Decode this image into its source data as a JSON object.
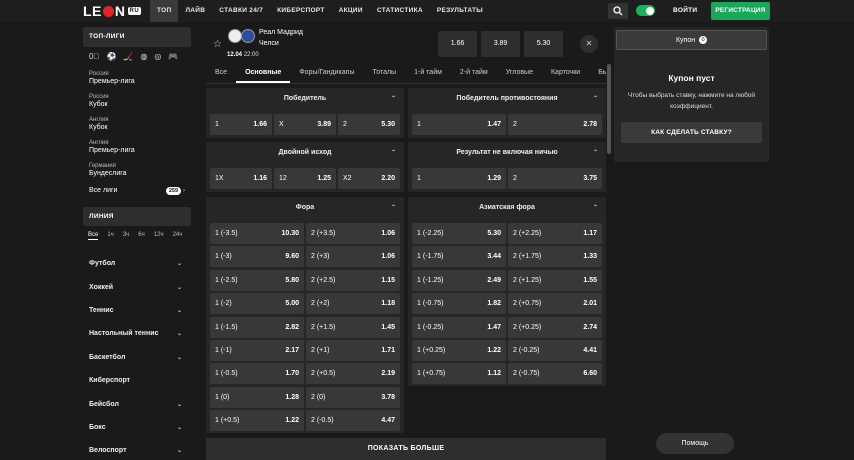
{
  "header": {
    "logo": "LEON",
    "logo_badge": "RU",
    "nav": [
      "ТОП",
      "ЛАЙВ",
      "СТАВКИ 24/7",
      "КИБЕРСПОРТ",
      "АКЦИИ",
      "СТАТИСТИКА",
      "РЕЗУЛЬТАТЫ"
    ],
    "login": "ВОЙТИ",
    "register": "РЕГИСТРАЦИЯ"
  },
  "sidebar": {
    "top_leagues_title": "ТОП-ЛИГИ",
    "leagues": [
      {
        "country": "Россия",
        "name": "Премьер-лига"
      },
      {
        "country": "Россия",
        "name": "Кубок"
      },
      {
        "country": "Англия",
        "name": "Кубок"
      },
      {
        "country": "Англия",
        "name": "Премьер-лига"
      },
      {
        "country": "Германия",
        "name": "Бундеслига"
      }
    ],
    "all_leagues": "Все лиги",
    "all_leagues_count": "259",
    "line_title": "ЛИНИЯ",
    "ranges": [
      "Все",
      "1ч",
      "3ч",
      "6ч",
      "12ч",
      "24ч"
    ],
    "sports": [
      "Футбол",
      "Хоккей",
      "Теннис",
      "Настольный теннис",
      "Баскетбол",
      "Киберспорт",
      "Бейсбол",
      "Бокс",
      "Велоспорт"
    ]
  },
  "match": {
    "team1": "Реал Мадрид",
    "team2": "Челси",
    "date": "12.04",
    "time": "22:00",
    "odds": [
      "1.66",
      "3.89",
      "5.30"
    ]
  },
  "tabs": [
    "Все",
    "Основные",
    "Форы/Гандикапы",
    "Тоталы",
    "1-й тайм",
    "2-й тайм",
    "Угловые",
    "Карточки",
    "Быст"
  ],
  "markets": {
    "winner": {
      "title": "Победитель",
      "outcomes": [
        [
          "1",
          "1.66"
        ],
        [
          "X",
          "3.89"
        ],
        [
          "2",
          "5.30"
        ]
      ]
    },
    "duel": {
      "title": "Победитель противостояния",
      "outcomes": [
        [
          "1",
          "1.47"
        ],
        [
          "2",
          "2.78"
        ]
      ]
    },
    "double": {
      "title": "Двойной исход",
      "outcomes": [
        [
          "1X",
          "1.16"
        ],
        [
          "12",
          "1.25"
        ],
        [
          "X2",
          "2.20"
        ]
      ]
    },
    "nodraw": {
      "title": "Результат не включая ничью",
      "outcomes": [
        [
          "1",
          "1.29"
        ],
        [
          "2",
          "3.75"
        ]
      ]
    },
    "handicap": {
      "title": "Фора",
      "rows": [
        [
          "1 (-3.5)",
          "10.30",
          "2 (+3.5)",
          "1.06"
        ],
        [
          "1 (-3)",
          "9.60",
          "2 (+3)",
          "1.06"
        ],
        [
          "1 (-2.5)",
          "5.80",
          "2 (+2.5)",
          "1.15"
        ],
        [
          "1 (-2)",
          "5.00",
          "2 (+2)",
          "1.18"
        ],
        [
          "1 (-1.5)",
          "2.82",
          "2 (+1.5)",
          "1.45"
        ],
        [
          "1 (-1)",
          "2.17",
          "2 (+1)",
          "1.71"
        ],
        [
          "1 (-0.5)",
          "1.70",
          "2 (+0.5)",
          "2.19"
        ],
        [
          "1 (0)",
          "1.28",
          "2 (0)",
          "3.78"
        ],
        [
          "1 (+0.5)",
          "1.22",
          "2 (-0.5)",
          "4.47"
        ]
      ]
    },
    "asian": {
      "title": "Азиатская фора",
      "rows": [
        [
          "1 (-2.25)",
          "5.30",
          "2 (+2.25)",
          "1.17"
        ],
        [
          "1 (-1.75)",
          "3.44",
          "2 (+1.75)",
          "1.33"
        ],
        [
          "1 (-1.25)",
          "2.49",
          "2 (+1.25)",
          "1.55"
        ],
        [
          "1 (-0.75)",
          "1.82",
          "2 (+0.75)",
          "2.01"
        ],
        [
          "1 (-0.25)",
          "1.47",
          "2 (+0.25)",
          "2.74"
        ],
        [
          "1 (+0.25)",
          "1.22",
          "2 (-0.25)",
          "4.41"
        ],
        [
          "1 (+0.75)",
          "1.12",
          "2 (-0.75)",
          "6.60"
        ]
      ]
    }
  },
  "show_more": "ПОКАЗАТЬ БОЛЬШЕ",
  "coupon": {
    "tab": "Купон",
    "count": "0",
    "empty_title": "Купон пуст",
    "empty_text": "Чтобы выбрать ставку, нажмите на любой коэффициент.",
    "how_to": "КАК СДЕЛАТЬ СТАВКУ?"
  },
  "help": "Помощь",
  "colors": {
    "accent": "#19a85a",
    "brand_red": "#e0242c",
    "bg": "#1a1a1a",
    "panel": "#262626",
    "button": "#383838"
  }
}
